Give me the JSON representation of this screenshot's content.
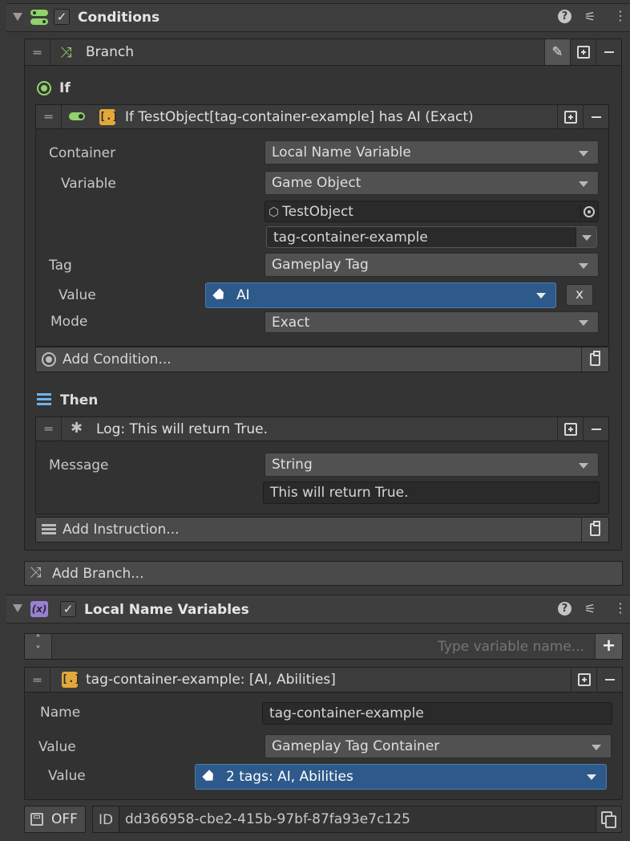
{
  "conditions": {
    "title": "Conditions",
    "branch": {
      "title": "Branch",
      "if_label": "If",
      "condition": {
        "title": "If TestObject[tag-container-example] has AI (Exact)",
        "container_label": "Container",
        "container_value": "Local Name Variable",
        "variable_label": "Variable",
        "variable_value": "Game Object",
        "object_value": "TestObject",
        "name_value": "tag-container-example",
        "tag_label": "Tag",
        "tag_value": "Gameplay Tag",
        "value_label": "Value",
        "value_value": "AI",
        "clear_label": "x",
        "mode_label": "Mode",
        "mode_value": "Exact"
      },
      "add_condition": "Add Condition...",
      "then_label": "Then",
      "instruction": {
        "title": "Log: This will return True.",
        "message_label": "Message",
        "message_type": "String",
        "message_value": "This will return True."
      },
      "add_instruction": "Add Instruction..."
    },
    "add_branch": "Add Branch..."
  },
  "local_vars": {
    "title": "Local Name Variables",
    "search_placeholder": "Type variable name...",
    "variable": {
      "title": "tag-container-example: [AI, Abilities]",
      "name_label": "Name",
      "name_value": "tag-container-example",
      "value_label": "Value",
      "value_type": "Gameplay Tag Container",
      "value_label2": "Value",
      "value_value": "2 tags: AI, Abilities"
    },
    "save_label": "OFF",
    "id_label": "ID",
    "id_value": "dd366958-cbe2-415b-97bf-87fa93e7c125"
  },
  "colors": {
    "accent_green": "#8fd46a",
    "accent_blue": "#2d5a8a",
    "accent_yellow": "#e2a838",
    "variables_purple": "#9a7fd6"
  }
}
